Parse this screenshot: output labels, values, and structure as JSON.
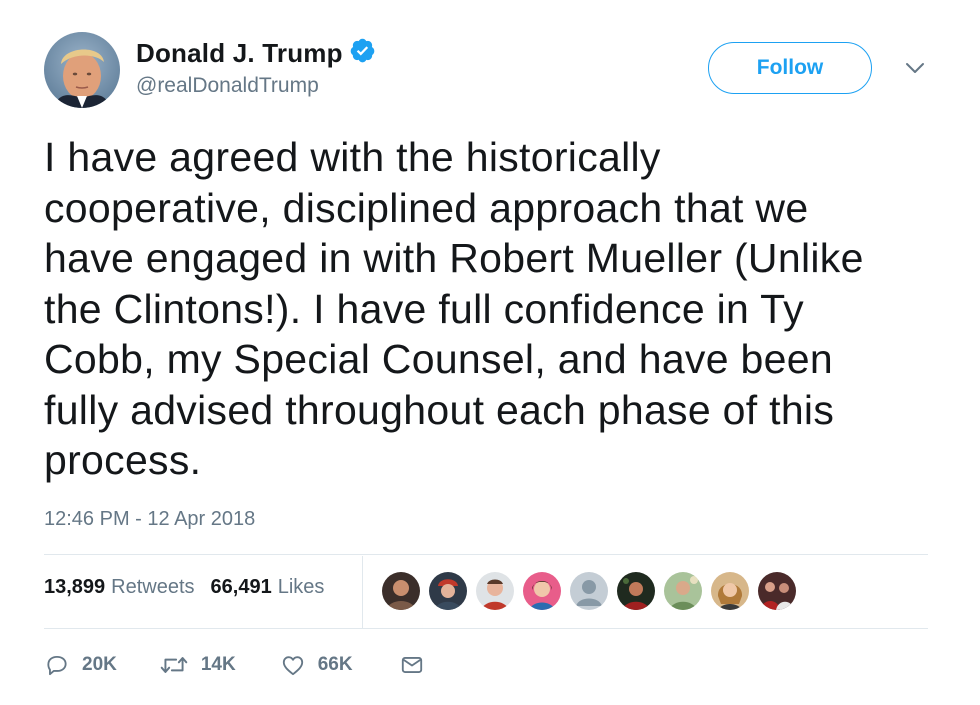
{
  "user": {
    "display_name": "Donald J. Trump",
    "handle": "@realDonaldTrump",
    "verified_icon": "verified-badge-icon"
  },
  "follow_label": "Follow",
  "tweet_text": "I have agreed with the historically\ncooperative, disciplined approach that we\nhave engaged in with Robert Mueller (Unlike\nthe Clintons!). I have full confidence in Ty\nCobb, my Special Counsel, and have been\nfully advised throughout each phase of this\nprocess.",
  "timestamp": "12:46 PM - 12 Apr 2018",
  "stats": {
    "retweets_count": "13,899",
    "retweets_label": "Retweets",
    "likes_count": "66,491",
    "likes_label": "Likes"
  },
  "actions": {
    "replies": "20K",
    "retweets": "14K",
    "likes": "66K"
  },
  "colors": {
    "accent": "#1da1f2",
    "muted": "#657786",
    "text": "#14171a",
    "divider": "#e1e8ed"
  }
}
